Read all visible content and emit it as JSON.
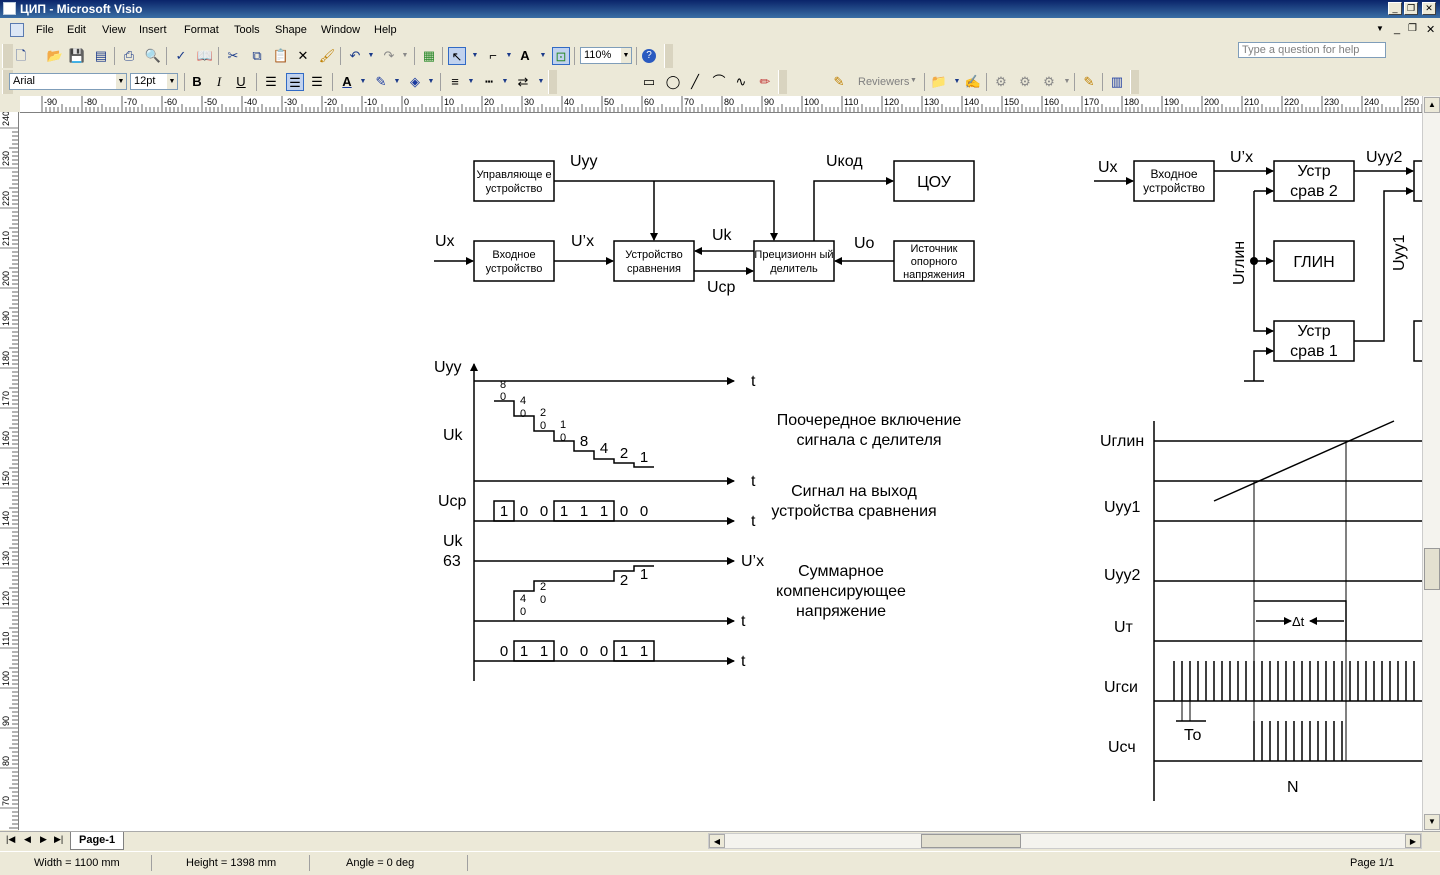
{
  "window": {
    "title": "ЦИП - Microsoft Visio"
  },
  "menu": [
    "File",
    "Edit",
    "View",
    "Insert",
    "Format",
    "Tools",
    "Shape",
    "Window",
    "Help"
  ],
  "help_placeholder": "Type a question for help",
  "toolbar": {
    "zoom": "110%",
    "font": "Arial",
    "size": "12pt",
    "reviewers": "Reviewers"
  },
  "ruler_h": [
    "-90",
    "-80",
    "-70",
    "-60",
    "-50",
    "-40",
    "-30",
    "-20",
    "-10",
    "0",
    "10",
    "20",
    "30",
    "40",
    "50",
    "60",
    "70",
    "80",
    "90",
    "100",
    "110",
    "120",
    "130",
    "140",
    "150",
    "160",
    "170",
    "180",
    "190",
    "200",
    "210",
    "220",
    "230",
    "240",
    "250"
  ],
  "ruler_v": [
    "240",
    "230",
    "220",
    "210",
    "200",
    "190",
    "180",
    "170",
    "160",
    "150",
    "140",
    "130",
    "120",
    "110",
    "100",
    "90",
    "80",
    "70"
  ],
  "diagram": {
    "blocks": {
      "control": "Управляюще е устройство",
      "input": "Входное устройство",
      "compare": "Устройство сравнения",
      "divider": "Прецизионн ый делитель",
      "cou": "ЦОУ",
      "ref": "Источник опорного напряжения"
    },
    "signals": {
      "uyy": "Uyy",
      "ukod": "Uкод",
      "ux": "Ux",
      "ux_prime": "U’x",
      "uk": "Uk",
      "uo": "Uo",
      "ucp": "Ucp"
    },
    "timing": {
      "uyy": "Uyy",
      "uk": "Uk",
      "ucp": "Ucp",
      "uk63": "Uk",
      "sixtythree": "63",
      "t": "t",
      "ux_prime": "U’x",
      "note1": "Поочередное включение сигнала с делителя",
      "note2": "Сигнал на выход устройства сравнения",
      "note3": "Суммарное компенсирующее напряжение",
      "bits1": [
        "1",
        "0",
        "0",
        "1",
        "1",
        "1",
        "0",
        "0"
      ],
      "bits2": [
        "0",
        "1",
        "1",
        "0",
        "0",
        "0",
        "1",
        "1"
      ],
      "steps1": [
        "8",
        "0",
        "4",
        "0",
        "2",
        "0",
        "1",
        "0",
        "8",
        "4",
        "2",
        "1"
      ],
      "steps2": [
        "4",
        "0",
        "2",
        "0",
        "2",
        "1"
      ]
    },
    "right": {
      "ux": "Ux",
      "ux_prime": "U’x",
      "input": "Входное устройство",
      "comp2": "Устр срав 2",
      "uyy2": "Uyy2",
      "ugl": "Uглин",
      "glin": "ГЛИН",
      "comp1": "Устр срав 1",
      "uyy1": "Uyy1"
    },
    "timing2": {
      "ugl": "Uглин",
      "uyy1": "Uyy1",
      "uyy2": "Uyy2",
      "ut": "Uт",
      "dt": "Δt",
      "ugsi": "Uгси",
      "to": "То",
      "usch": "Uсч",
      "n": "N"
    }
  },
  "tabs": {
    "page": "Page-1"
  },
  "status": {
    "width": "Width = 1100 mm",
    "height": "Height = 1398 mm",
    "angle": "Angle = 0 deg",
    "page": "Page 1/1"
  }
}
